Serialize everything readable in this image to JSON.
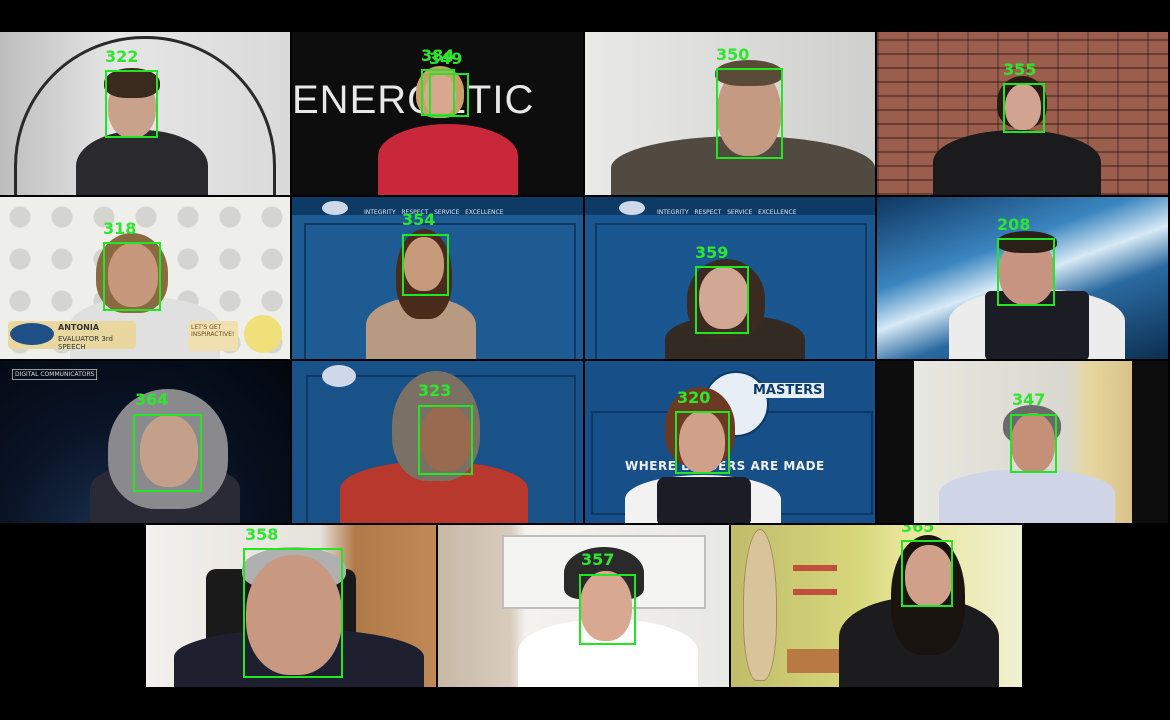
{
  "tiles": [
    {
      "id": "t1",
      "face_id": "322",
      "bg": "#dcdcdc",
      "shirt": "#1d1d1f",
      "skin": "#c9a28c",
      "hair": "#3a2a1e"
    },
    {
      "id": "t2",
      "face_id_a": "384",
      "face_id_b": "349",
      "bg": "#0c0c0c",
      "shirt": "#c8283a",
      "skin": "#d9a690",
      "hair": "#caa06a",
      "banner": "ENERGETIC"
    },
    {
      "id": "t3",
      "face_id": "350",
      "bg": "#d8d8d6",
      "shirt": "#514a40",
      "skin": "#c49a82",
      "hair": "#5a4a38"
    },
    {
      "id": "t4",
      "face_id": "355",
      "bg": "#8a5243",
      "shirt": "#1b1b1e",
      "skin": "#d0a490",
      "hair": "#2a1a14"
    },
    {
      "id": "t5",
      "face_id": "318",
      "bg": "#ebebe8",
      "shirt": "#e0e0e0",
      "skin": "#c8987c",
      "hair": "#8a6a40",
      "name_line1": "ANTONIA",
      "name_line2": "EVALUATOR 3rd SPEECH",
      "badge_text": "LET'S GET INSPIRED",
      "badge_text2": "LET'S GET INSPIRACTIVE!"
    },
    {
      "id": "t6",
      "face_id": "354",
      "bg": "#1d5b92",
      "shirt": "#b89a82",
      "skin": "#c89a7c",
      "hair": "#4a2a1a",
      "values_bar": "INTEGRITY   RESPECT   SERVICE   EXCELLENCE"
    },
    {
      "id": "t7",
      "face_id": "359",
      "bg": "#1a5690",
      "shirt": "#332a24",
      "skin": "#d0a894",
      "hair": "#3a2a20",
      "values_bar": "INTEGRITY   RESPECT   SERVICE   EXCELLENCE"
    },
    {
      "id": "t8",
      "face_id": "208",
      "bg": "#1d4f80",
      "shirt": "#ececec",
      "skin": "#c89482",
      "hair": "#2a2018"
    },
    {
      "id": "t9",
      "face_id": "364",
      "bg": "#061020",
      "shirt": "#2a2a36",
      "skin": "#c4a08a",
      "hair": "#8a8a8e",
      "header": "DIGITAL COMMUNICATORS"
    },
    {
      "id": "t10",
      "face_id": "323",
      "bg": "#195288",
      "shirt": "#b8382e",
      "skin": "#9a6a50",
      "hair": "#7a7064"
    },
    {
      "id": "t11",
      "face_id": "320",
      "bg": "#175088",
      "shirt": "#f2f2f2",
      "skin": "#d0a088",
      "hair": "#6a3a22",
      "slogan": "WHERE LEADERS ARE MADE",
      "logo_text": "MASTERS"
    },
    {
      "id": "t12",
      "face_id": "347",
      "bg": "#e0e0d8",
      "shirt": "#cfd5e6",
      "skin": "#c49078",
      "hair": "#6a6a6a"
    },
    {
      "id": "t13",
      "face_id": "358",
      "bg": "#ece9e4",
      "shirt": "#1e2030",
      "skin": "#c89880",
      "hair": "#b0b0b0"
    },
    {
      "id": "t14",
      "face_id": "357",
      "bg": "#e6e4e0",
      "shirt": "#ffffff",
      "skin": "#d8a890",
      "hair": "#8a5a32"
    },
    {
      "id": "t15",
      "face_id": "365",
      "bg": "#d4d27a",
      "shirt": "#1c1c1e",
      "skin": "#d0a08a",
      "hair": "#1a1410"
    }
  ],
  "colors": {
    "detect_box": "#22e622",
    "background": "#000000"
  }
}
